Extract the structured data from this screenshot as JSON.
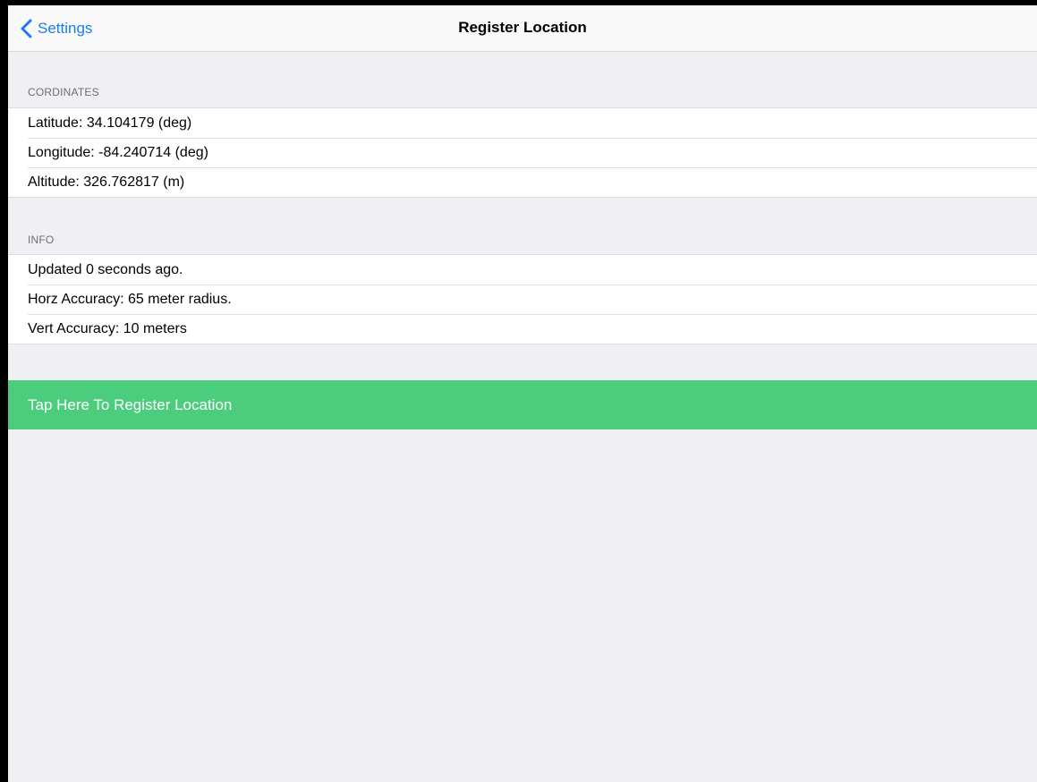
{
  "colors": {
    "accent": "#1a7cf5",
    "register_green": "#4ccd7e"
  },
  "navbar": {
    "back_label": "Settings",
    "back_icon": "chevron-left-icon",
    "title": "Register Location"
  },
  "coordinates": {
    "header": "CORDINATES",
    "rows": [
      "Latitude: 34.104179 (deg)",
      "Longitude: -84.240714 (deg)",
      "Altitude: 326.762817 (m)"
    ]
  },
  "info": {
    "header": "INFO",
    "rows": [
      "Updated 0 seconds ago.",
      "Horz Accuracy: 65 meter radius.",
      "Vert Accuracy: 10 meters"
    ]
  },
  "register_button": {
    "label": "Tap Here To Register Location"
  }
}
